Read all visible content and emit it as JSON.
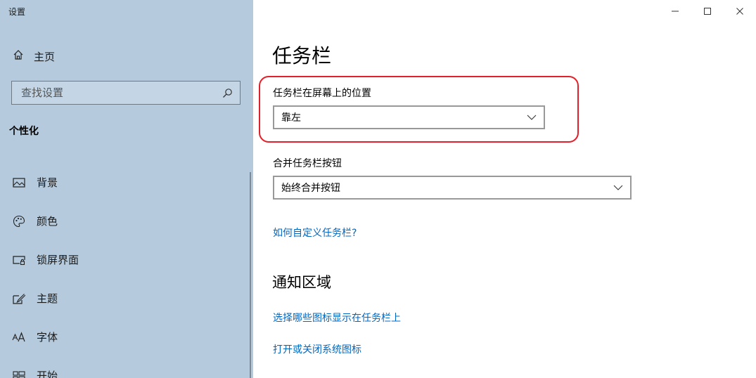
{
  "window": {
    "title": "设置"
  },
  "sidebar": {
    "home_label": "主页",
    "search_placeholder": "查找设置",
    "section_heading": "个性化",
    "items": [
      {
        "label": "背景",
        "icon": "picture-icon"
      },
      {
        "label": "颜色",
        "icon": "palette-icon"
      },
      {
        "label": "锁屏界面",
        "icon": "lock-screen-icon"
      },
      {
        "label": "主题",
        "icon": "theme-brush-icon"
      },
      {
        "label": "字体",
        "icon": "font-icon"
      },
      {
        "label": "开始",
        "icon": "start-menu-icon"
      }
    ]
  },
  "main": {
    "title": "任务栏",
    "position_label": "任务栏在屏幕上的位置",
    "position_value": "靠左",
    "combine_label": "合并任务栏按钮",
    "combine_value": "始终合并按钮",
    "customize_link": "如何自定义任务栏?",
    "notification_heading": "通知区域",
    "select_icons_link": "选择哪些图标显示在任务栏上",
    "system_icons_link": "打开或关闭系统图标"
  },
  "colors": {
    "sidebar_bg": "#b5cbdd",
    "link": "#0067c0",
    "highlight": "#e0202a"
  }
}
